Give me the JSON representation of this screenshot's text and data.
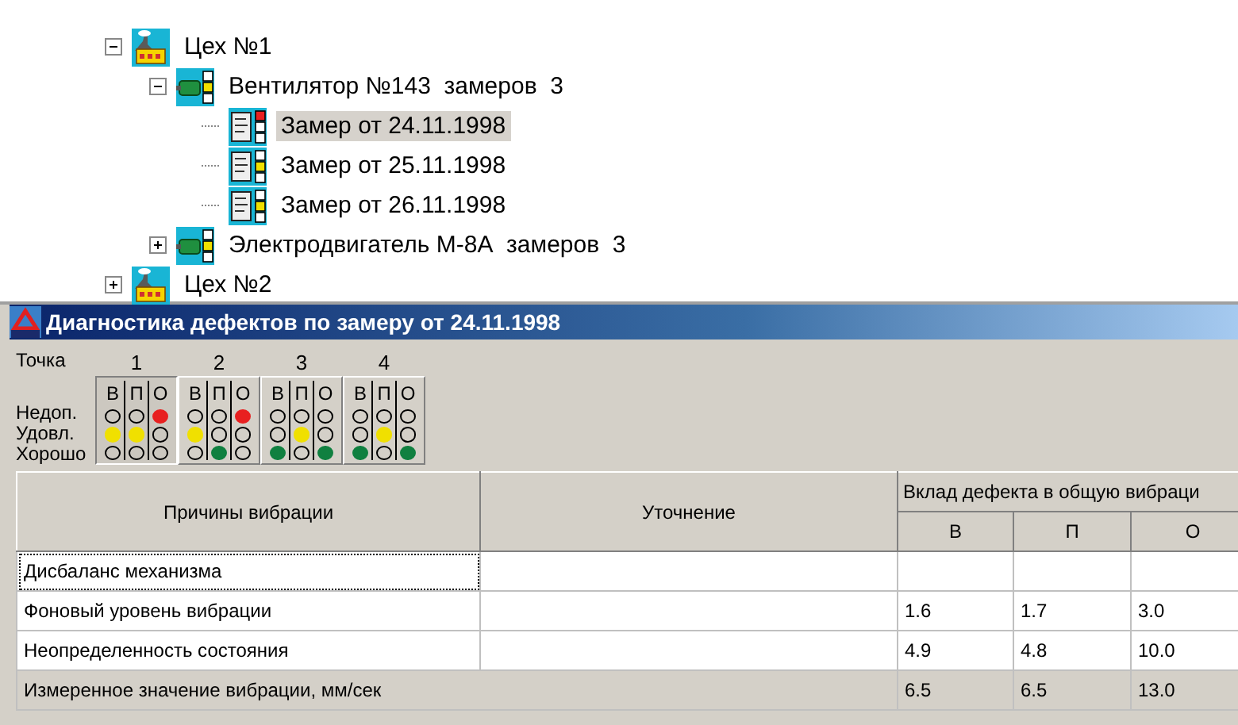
{
  "tree": [
    {
      "kind": "workshop",
      "label": "Цех №1",
      "expanded": true,
      "selected": false,
      "children": [
        {
          "kind": "machine",
          "label": "Вентилятор №143  замеров  3",
          "alarm": false,
          "warning": true,
          "expanded": true,
          "selected": false,
          "children": [
            {
              "kind": "measurement",
              "label": "Замер от 24.11.1998",
              "alarm": true,
              "warning": false,
              "selected": true
            },
            {
              "kind": "measurement",
              "label": "Замер от 25.11.1998",
              "alarm": false,
              "warning": true,
              "selected": false
            },
            {
              "kind": "measurement",
              "label": "Замер от 26.11.1998",
              "alarm": false,
              "warning": true,
              "selected": false
            }
          ]
        },
        {
          "kind": "machine",
          "label": "Электродвигатель М-8А  замеров  3",
          "alarm": false,
          "warning": true,
          "expanded": false,
          "selected": false
        }
      ]
    },
    {
      "kind": "workshop",
      "label": "Цех №2",
      "expanded": false,
      "selected": false
    }
  ],
  "panel": {
    "title": "Диагностика дефектов по замеру от 24.11.1998",
    "point_label": "Точка",
    "level_labels": [
      "Недоп.",
      "Удовл.",
      "Хорошо"
    ],
    "points": [
      {
        "number": "1",
        "selected": true,
        "channels": [
          {
            "axis": "В",
            "unacceptable": false,
            "satisfactory": true,
            "good": false
          },
          {
            "axis": "П",
            "unacceptable": false,
            "satisfactory": true,
            "good": false
          },
          {
            "axis": "О",
            "unacceptable": true,
            "satisfactory": false,
            "good": false
          }
        ]
      },
      {
        "number": "2",
        "selected": false,
        "channels": [
          {
            "axis": "В",
            "unacceptable": false,
            "satisfactory": true,
            "good": false
          },
          {
            "axis": "П",
            "unacceptable": false,
            "satisfactory": false,
            "good": true
          },
          {
            "axis": "О",
            "unacceptable": true,
            "satisfactory": false,
            "good": false
          }
        ]
      },
      {
        "number": "3",
        "selected": false,
        "channels": [
          {
            "axis": "В",
            "unacceptable": false,
            "satisfactory": false,
            "good": true
          },
          {
            "axis": "П",
            "unacceptable": false,
            "satisfactory": true,
            "good": false
          },
          {
            "axis": "О",
            "unacceptable": false,
            "satisfactory": false,
            "good": true
          }
        ]
      },
      {
        "number": "4",
        "selected": false,
        "channels": [
          {
            "axis": "В",
            "unacceptable": false,
            "satisfactory": false,
            "good": true
          },
          {
            "axis": "П",
            "unacceptable": false,
            "satisfactory": true,
            "good": false
          },
          {
            "axis": "О",
            "unacceptable": false,
            "satisfactory": false,
            "good": true
          }
        ]
      }
    ]
  },
  "table": {
    "columns": [
      "Причины вибрации",
      "Уточнение"
    ],
    "group_column": "Вклад дефекта в общую вибраци",
    "sub_columns": [
      "В",
      "П",
      "О"
    ],
    "rows": [
      {
        "cause": "Дисбаланс механизма",
        "focused": true
      },
      {
        "cause": "Фоновый уровень вибрации",
        "focused": false,
        "values": [
          "1.6",
          "1.7",
          "3.0"
        ]
      },
      {
        "cause": "Неопределенность состояния",
        "focused": false,
        "values": [
          "4.9",
          "4.8",
          "10.0"
        ]
      }
    ],
    "total": {
      "label": "Измеренное значение вибрации, мм/сек",
      "values": [
        "6.5",
        "6.5",
        "13.0"
      ]
    }
  }
}
